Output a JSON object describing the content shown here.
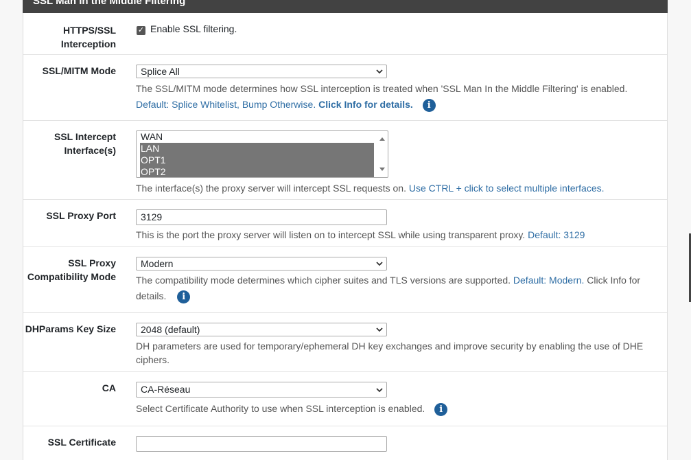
{
  "section": {
    "title": "SSL Man In the Middle Filtering"
  },
  "fields": {
    "https_ssl": {
      "label_line1": "HTTPS/SSL",
      "label_line2": "Interception",
      "checkbox_label": "Enable SSL filtering.",
      "checked": true
    },
    "mitm_mode": {
      "label": "SSL/MITM Mode",
      "value": "Splice All",
      "help": "The SSL/MITM mode determines how SSL interception is treated when 'SSL Man In the Middle Filtering' is enabled.",
      "default": "Default: Splice Whitelist, Bump Otherwise.",
      "info_link": "Click Info for details."
    },
    "intercept_interfaces": {
      "label_line1": "SSL Intercept",
      "label_line2": "Interface(s)",
      "options": [
        "WAN",
        "LAN",
        "OPT1",
        "OPT2"
      ],
      "help": "The interface(s) the proxy server will intercept SSL requests on.",
      "hint": "Use CTRL + click to select multiple interfaces."
    },
    "proxy_port": {
      "label": "SSL Proxy Port",
      "value": "3129",
      "help": "This is the port the proxy server will listen on to intercept SSL while using transparent proxy.",
      "default": "Default: 3129"
    },
    "compat_mode": {
      "label_line1": "SSL Proxy",
      "label_line2": "Compatibility Mode",
      "value": "Modern",
      "help": "The compatibility mode determines which cipher suites and TLS versions are supported.",
      "default": "Default: Modern.",
      "info_tail": "Click Info for",
      "info_tail2": "details."
    },
    "dhparams": {
      "label": "DHParams Key Size",
      "value": "2048 (default)",
      "help_line1": "DH parameters are used for temporary/ephemeral DH key exchanges and improve security by enabling the use of DHE",
      "help_line2": "ciphers."
    },
    "ca": {
      "label": "CA",
      "value": "CA-Réseau",
      "help": "Select Certificate Authority to use when SSL interception is enabled."
    },
    "ssl_cert": {
      "label": "SSL Certificate"
    }
  },
  "icons": {
    "info": "info-icon",
    "chevron": "chevron-down-icon",
    "check": "checkmark-icon"
  }
}
